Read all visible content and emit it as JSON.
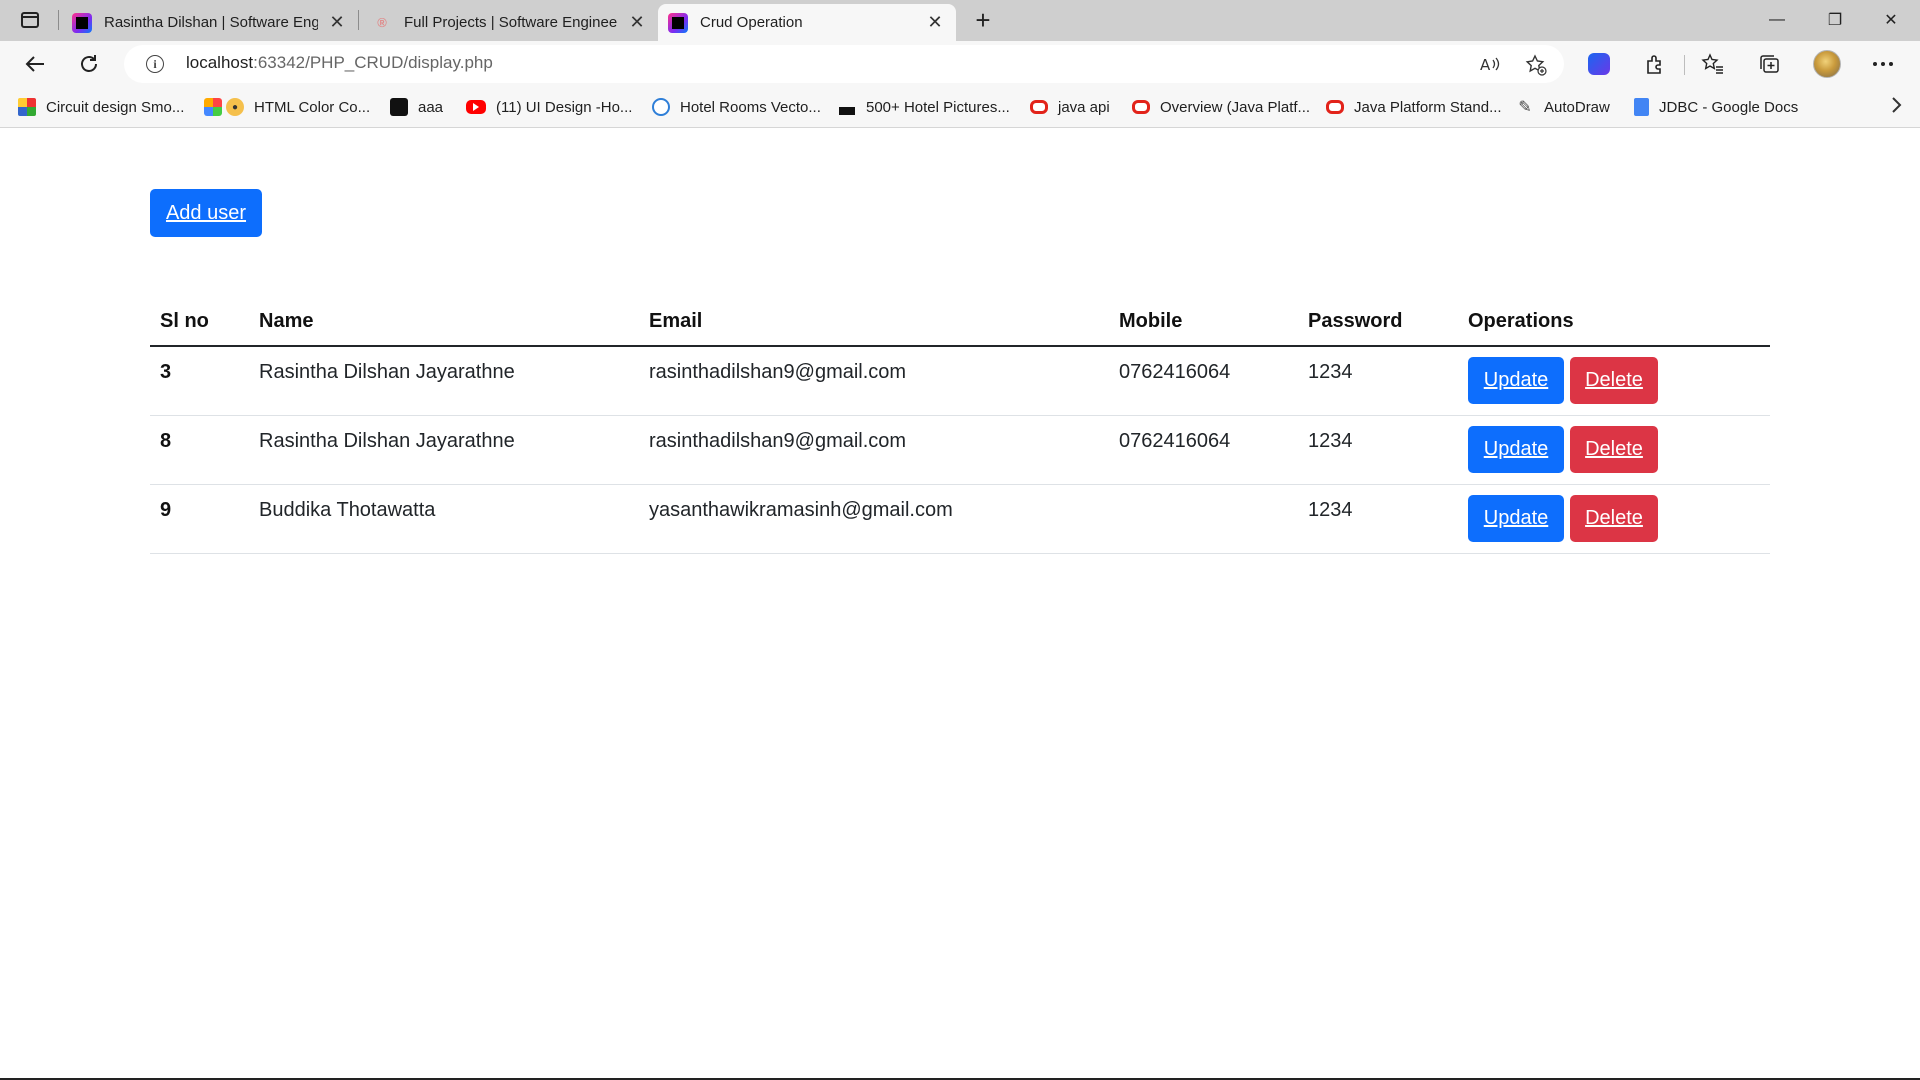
{
  "browser": {
    "tabs": [
      {
        "title": "Rasintha Dilshan | Software Engi",
        "favicon": "intellij-icon",
        "active": false
      },
      {
        "title": "Full Projects | Software Engineer",
        "favicon": "page-icon",
        "active": false
      },
      {
        "title": "Crud Operation",
        "favicon": "intellij-icon",
        "active": true
      }
    ],
    "tab_close_glyph": "✕",
    "new_tab_glyph": "+",
    "window_controls": {
      "minimize": "—",
      "restore": "❐",
      "close": "✕"
    },
    "address": {
      "host": "localhost",
      "rest": ":63342/PHP_CRUD/display.php"
    },
    "bookmarks": [
      {
        "label": "Circuit design Smo...",
        "icon": "grid-icon"
      },
      {
        "label": "HTML Color Co...",
        "icon": "palette-icon"
      },
      {
        "label": "aaa",
        "icon": "black-square-icon"
      },
      {
        "label": "(11) UI Design -Ho...",
        "icon": "youtube-icon"
      },
      {
        "label": "Hotel Rooms Vecto...",
        "icon": "vector-icon"
      },
      {
        "label": "500+ Hotel Pictures...",
        "icon": "unsplash-icon"
      },
      {
        "label": "java api",
        "icon": "oracle-icon"
      },
      {
        "label": "Overview (Java Platf...",
        "icon": "oracle-icon"
      },
      {
        "label": "Java Platform Stand...",
        "icon": "oracle-icon"
      },
      {
        "label": "AutoDraw",
        "icon": "autodraw-icon"
      },
      {
        "label": "JDBC - Google Docs",
        "icon": "docs-icon"
      }
    ]
  },
  "page": {
    "add_button": "Add user",
    "table": {
      "headers": [
        "Sl no",
        "Name",
        "Email",
        "Mobile",
        "Password",
        "Operations"
      ],
      "rows": [
        {
          "sl": "3",
          "name": "Rasintha Dilshan Jayarathne",
          "email": "rasinthadilshan9@gmail.com",
          "mobile": "0762416064",
          "password": "1234"
        },
        {
          "sl": "8",
          "name": "Rasintha Dilshan Jayarathne",
          "email": "rasinthadilshan9@gmail.com",
          "mobile": "0762416064",
          "password": "1234"
        },
        {
          "sl": "9",
          "name": "Buddika Thotawatta",
          "email": "yasanthawikramasinh@gmail.com",
          "mobile": "",
          "password": "1234"
        }
      ],
      "update_label": "Update",
      "delete_label": "Delete"
    }
  },
  "colors": {
    "primary": "#0d6efd",
    "danger": "#dc3545",
    "tabstrip": "#cfcfcf",
    "toolbar": "#f7f7f7"
  }
}
